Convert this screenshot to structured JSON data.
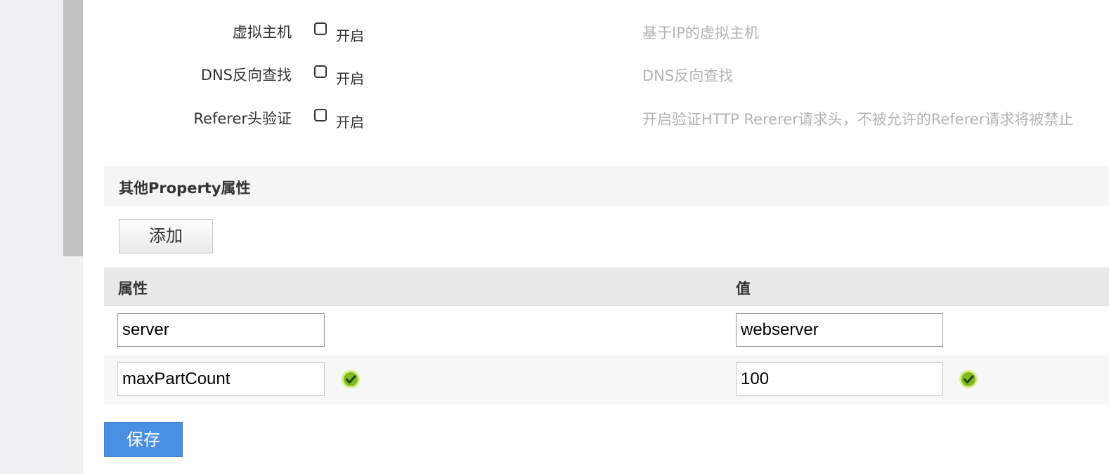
{
  "options": [
    {
      "label": "虚拟主机",
      "checkbox_label": "开启",
      "checked": false,
      "description": "基于IP的虚拟主机"
    },
    {
      "label": "DNS反向查找",
      "checkbox_label": "开启",
      "checked": false,
      "description": "DNS反向查找"
    },
    {
      "label": "Referer头验证",
      "checkbox_label": "开启",
      "checked": false,
      "description": "开启验证HTTP Rererer请求头，不被允许的Referer请求将被禁止"
    }
  ],
  "properties_section": {
    "title": "其他Property属性",
    "add_label": "添加",
    "columns": {
      "property": "属性",
      "value": "值"
    },
    "rows": [
      {
        "property": "server",
        "value": "webserver",
        "validated": false
      },
      {
        "property": "maxPartCount",
        "value": "100",
        "validated": true
      }
    ]
  },
  "save_label": "保存",
  "colors": {
    "accent": "#4a90e2",
    "ok": "#7dbb1f"
  }
}
